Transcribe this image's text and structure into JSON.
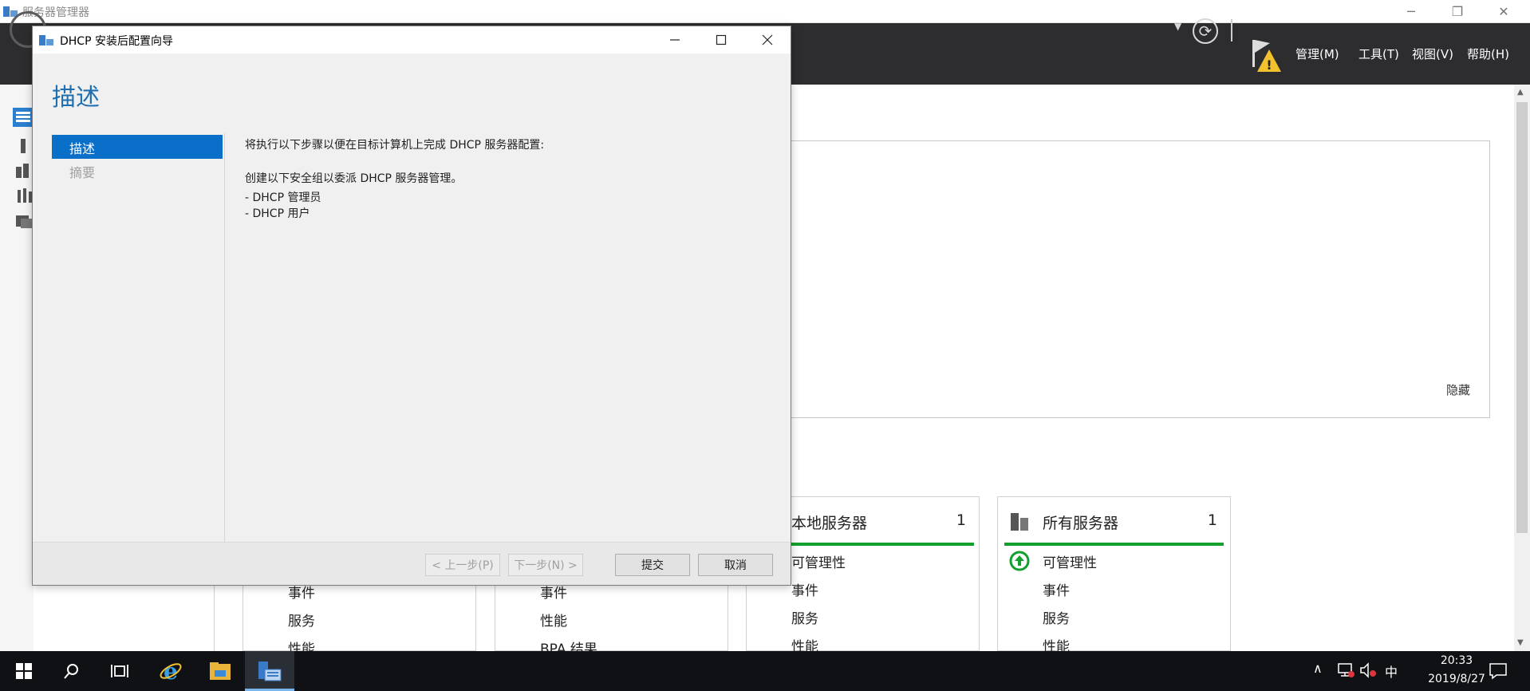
{
  "window": {
    "title": "服务器管理器",
    "minimize": "─",
    "restore": "❐",
    "close": "✕"
  },
  "header": {
    "menus": [
      "管理(M)",
      "工具(T)",
      "视图(V)",
      "帮助(H)"
    ]
  },
  "welcome": {
    "hide_label": "隐藏"
  },
  "tiles": [
    {
      "title": "本地服务器",
      "count": "1",
      "rows": [
        "可管理性",
        "事件",
        "服务",
        "性能"
      ]
    },
    {
      "title": "所有服务器",
      "count": "1",
      "rows": [
        "可管理性",
        "事件",
        "服务",
        "性能"
      ]
    }
  ],
  "background_tiles": {
    "col1": [
      "事件",
      "服务",
      "性能"
    ],
    "col2": [
      "事件",
      "性能",
      "BPA 结果"
    ]
  },
  "dialog": {
    "title": "DHCP 安装后配置向导",
    "heading": "描述",
    "nav": [
      "描述",
      "摘要"
    ],
    "body": {
      "line1": "将执行以下步骤以便在目标计算机上完成 DHCP 服务器配置:",
      "line2": "创建以下安全组以委派 DHCP 服务器管理。",
      "line3": "- DHCP 管理员",
      "line4": "- DHCP 用户"
    },
    "buttons": {
      "prev": "< 上一步(P)",
      "next": "下一步(N) >",
      "submit": "提交",
      "cancel": "取消"
    }
  },
  "taskbar": {
    "ime": "中",
    "time": "20:33",
    "date": "2019/8/27"
  },
  "colors": {
    "accent": "#0a6fc9",
    "header_bg": "#2d2d30",
    "status_green": "#14a02e",
    "taskbar_bg": "#101114"
  }
}
